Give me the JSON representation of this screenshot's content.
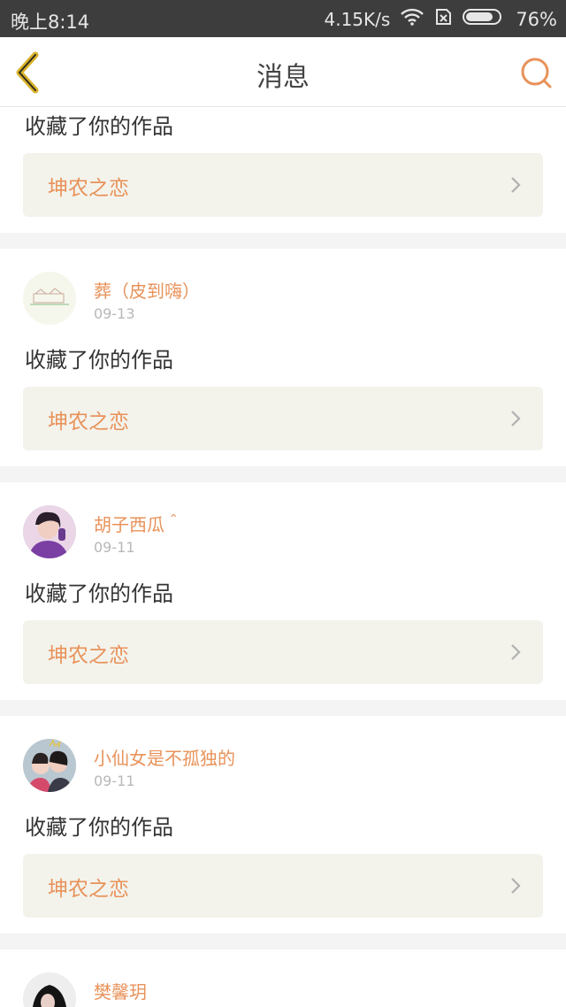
{
  "status_bar": {
    "time": "晚上8:14",
    "network_speed": "4.15K/s",
    "battery": "76%"
  },
  "header": {
    "title": "消息",
    "back_icon": "back-chevron-icon",
    "search_icon": "search-icon"
  },
  "colors": {
    "accent": "#e8925a",
    "back_icon": "#d8b22b",
    "card_bg": "#ffffff",
    "work_box_bg": "#f3f3ec"
  },
  "messages": [
    {
      "action": "收藏了你的作品",
      "work_title": "坤农之恋"
    },
    {
      "username": "葬（皮到嗨）",
      "date": "09-13",
      "action": "收藏了你的作品",
      "work_title": "坤农之恋"
    },
    {
      "username": "胡子西瓜＾",
      "date": "09-11",
      "action": "收藏了你的作品",
      "work_title": "坤农之恋"
    },
    {
      "username": "小仙女是不孤独的",
      "date": "09-11",
      "action": "收藏了你的作品",
      "work_title": "坤农之恋"
    },
    {
      "username": "樊馨玥"
    }
  ]
}
